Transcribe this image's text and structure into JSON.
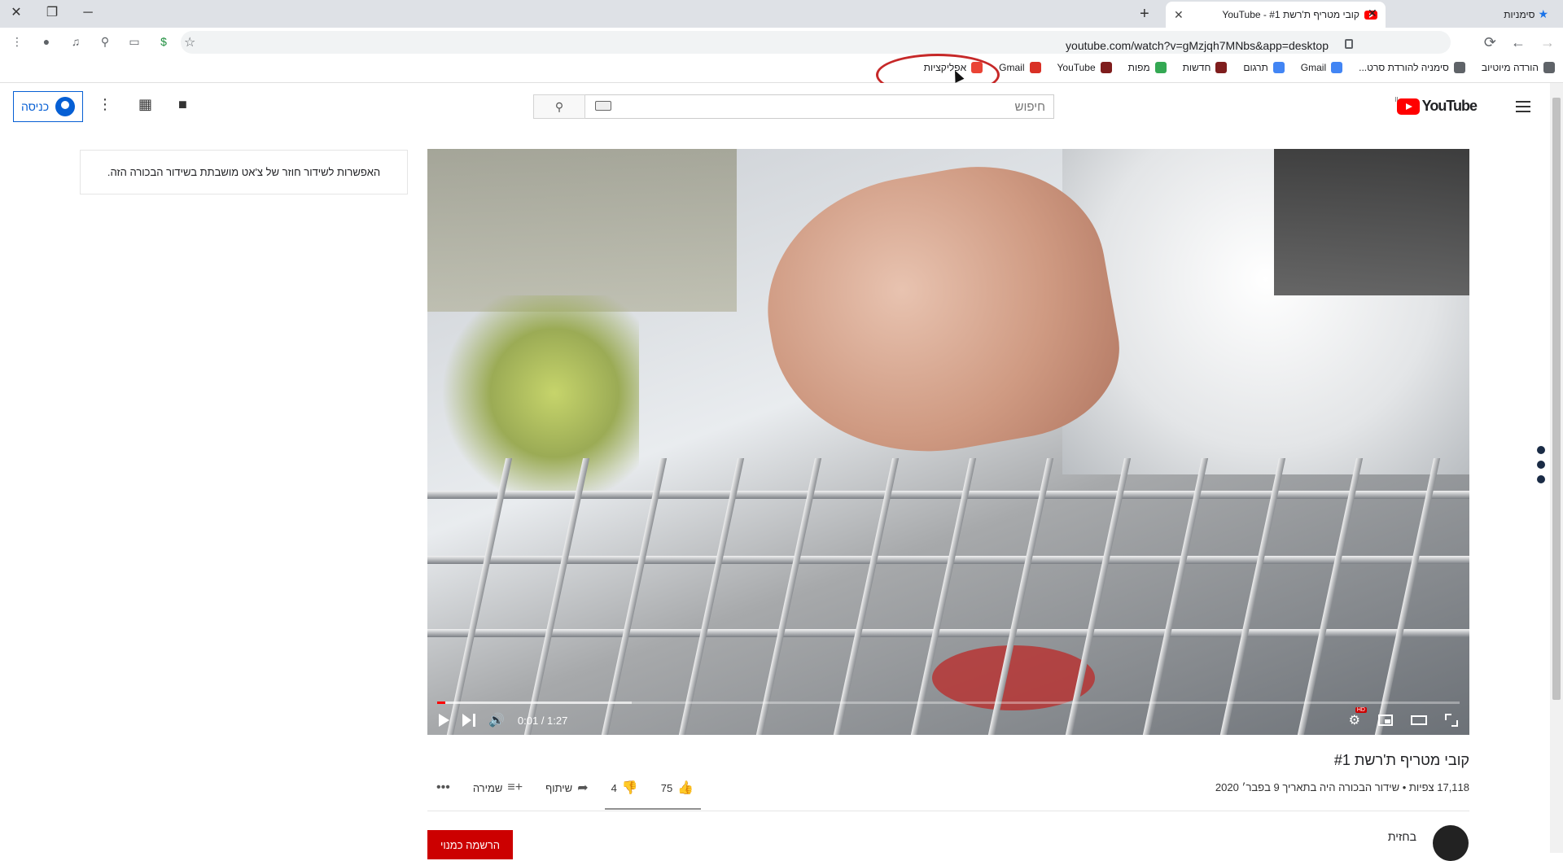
{
  "browser": {
    "bookmarks_label": "סימניות",
    "tab": {
      "title": "קובי מטריף ת'רשת #1 - YouTube"
    },
    "url": "youtube.com/watch?v=gMzjqh7MNbs&app=desktop"
  },
  "bookmarks": [
    {
      "label": "אפליקציות",
      "icon": "apps-grid-icon",
      "color": "#ea4335"
    },
    {
      "label": "Gmail",
      "icon": "gmail-icon",
      "color": "#d93025"
    },
    {
      "label": "YouTube",
      "icon": "shield-icon",
      "color": "#7f1d1d"
    },
    {
      "label": "מפות",
      "icon": "maps-pin-icon",
      "color": "#34a853"
    },
    {
      "label": "חדשות",
      "icon": "shield-icon",
      "color": "#7f1d1d"
    },
    {
      "label": "תרגום",
      "icon": "translate-icon",
      "color": "#4285f4"
    },
    {
      "label": "Gmail",
      "icon": "google-icon",
      "color": "#4285f4"
    },
    {
      "label": "סימניה להורדת סרט...",
      "icon": "search-icon",
      "color": "#5f6368"
    },
    {
      "label": "הורדה מיוטיוב",
      "icon": "globe-icon",
      "color": "#5f6368"
    }
  ],
  "youtube": {
    "signin_label": "כניסה",
    "search_placeholder": "חיפוש",
    "logo_text": "YouTube",
    "country": "IL"
  },
  "chat": {
    "message": "האפשרות לשידור חוזר של צ'אט מושבתת בשידור הבכורה הזה."
  },
  "player": {
    "time": "0:01 / 1:27",
    "progress": {
      "played": 0.008,
      "buffered": 0.19
    },
    "hd": "HD"
  },
  "video": {
    "title": "קובי מטריף ת'רשת #1",
    "meta": "17,118 צפיות • שידור הבכורה היה בתאריך 9 בפבר׳ 2020",
    "likes": "75",
    "dislikes": "4",
    "share_label": "שיתוף",
    "save_label": "שמירה"
  },
  "channel": {
    "name": "בחזית",
    "subscribe_label": "הרשמה כמנוי"
  }
}
